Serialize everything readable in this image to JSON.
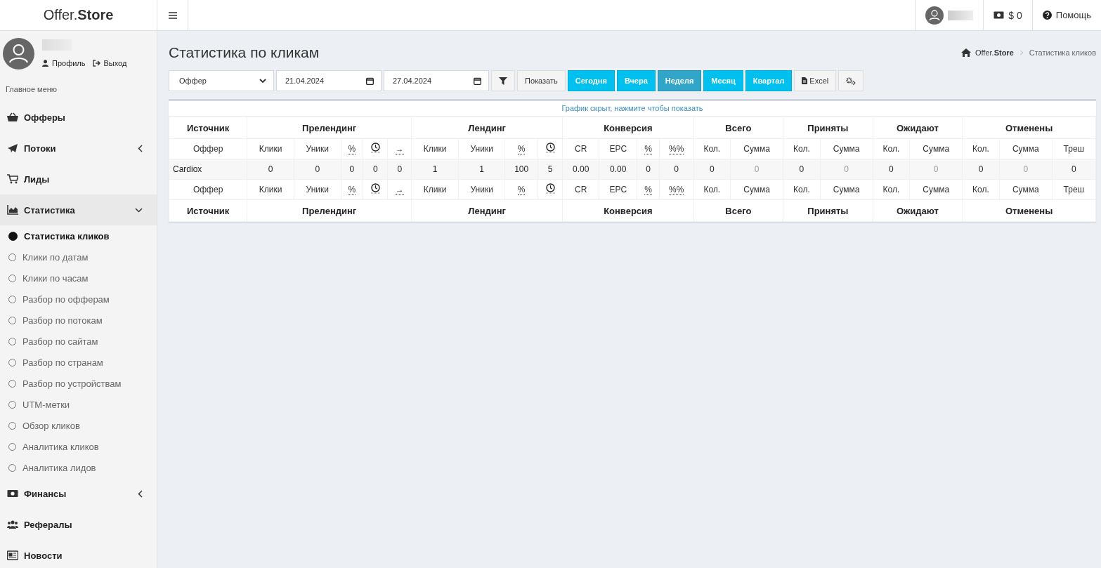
{
  "brand": "Offer.**Store**",
  "topbar": {
    "balance": "$ 0",
    "help": "Помощь"
  },
  "user_panel": {
    "links": [
      "Профиль",
      "Выход"
    ]
  },
  "menu_header": "Главное меню",
  "menu": [
    {
      "label": "Офферы"
    },
    {
      "label": "Потоки",
      "expanded": false
    },
    {
      "label": "Лиды"
    },
    {
      "label": "Статистика",
      "expanded": true,
      "children": [
        {
          "label": "Статистика кликов",
          "selected": true
        },
        {
          "label": "Клики по датам",
          "selected": false
        },
        {
          "label": "Клики по часам",
          "selected": false
        },
        {
          "label": "Разбор по офферам",
          "selected": false
        },
        {
          "label": "Разбор по потокам",
          "selected": false
        },
        {
          "label": "Разбор по сайтам",
          "selected": false
        },
        {
          "label": "Разбор по странам",
          "selected": false
        },
        {
          "label": "Разбор по устройствам",
          "selected": false
        },
        {
          "label": "UTM-метки",
          "selected": false
        },
        {
          "label": "Обзор кликов",
          "selected": false
        },
        {
          "label": "Аналитика кликов",
          "selected": false
        },
        {
          "label": "Аналитика лидов",
          "selected": false
        }
      ]
    },
    {
      "label": "Финансы",
      "expanded": false
    },
    {
      "label": "Рефералы"
    },
    {
      "label": "Новости"
    }
  ],
  "page_title": "Статистика по кликам",
  "breadcrumb": {
    "home": "Offer.**Store**",
    "current": "Статистика кликов"
  },
  "filters": {
    "select": "Оффер",
    "date_from": "21.04.2024",
    "date_to": "27.04.2024"
  },
  "buttons": [
    {
      "kind": "filter"
    },
    {
      "kind": "default",
      "label": "Показать"
    },
    {
      "kind": "period",
      "label": "Сегодня",
      "selected": false
    },
    {
      "kind": "period",
      "label": "Вчера",
      "selected": false
    },
    {
      "kind": "period",
      "label": "Неделя",
      "selected": true
    },
    {
      "kind": "period",
      "label": "Месяц",
      "selected": false
    },
    {
      "kind": "period",
      "label": "Квартал",
      "selected": false
    },
    {
      "kind": "excel",
      "label": "Excel"
    },
    {
      "kind": "settings"
    }
  ],
  "chart_toggle": "График скрыт, нажмите чтобы показать",
  "table": {
    "header": [
      {
        "label": "Источник",
        "columns": [
          {
            "kind": "text",
            "label": "Оффер"
          }
        ]
      },
      {
        "label": "Прелендинг",
        "columns": [
          {
            "kind": "text",
            "label": "Клики"
          },
          {
            "kind": "text",
            "label": "Уники"
          },
          {
            "kind": "abbr",
            "label": "%"
          },
          {
            "kind": "clock"
          },
          {
            "kind": "abbr",
            "label": "→"
          }
        ]
      },
      {
        "label": "Лендинг",
        "columns": [
          {
            "kind": "text",
            "label": "Клики"
          },
          {
            "kind": "text",
            "label": "Уники"
          },
          {
            "kind": "abbr",
            "label": "%"
          },
          {
            "kind": "clock"
          }
        ]
      },
      {
        "label": "Конверсия",
        "columns": [
          {
            "kind": "text",
            "label": "CR"
          },
          {
            "kind": "text",
            "label": "EPC"
          },
          {
            "kind": "abbr",
            "label": "%"
          },
          {
            "kind": "abbr",
            "label": "%%"
          }
        ]
      },
      {
        "label": "Всего",
        "columns": [
          {
            "kind": "text",
            "label": "Кол."
          },
          {
            "kind": "text",
            "label": "Сумма"
          }
        ]
      },
      {
        "label": "Приняты",
        "columns": [
          {
            "kind": "text",
            "label": "Кол."
          },
          {
            "kind": "text",
            "label": "Сумма"
          }
        ]
      },
      {
        "label": "Ожидают",
        "columns": [
          {
            "kind": "text",
            "label": "Кол."
          },
          {
            "kind": "text",
            "label": "Сумма"
          }
        ]
      },
      {
        "label": "Отменены",
        "columns": [
          {
            "kind": "text",
            "label": "Кол."
          },
          {
            "kind": "text",
            "label": "Сумма"
          },
          {
            "kind": "text",
            "label": "Треш"
          }
        ]
      }
    ],
    "rows": [
      [
        {
          "text": "Cardiox",
          "muted": false
        },
        {
          "text": "0",
          "muted": false
        },
        {
          "text": "0",
          "muted": false
        },
        {
          "text": "0",
          "muted": false
        },
        {
          "text": "0",
          "muted": false
        },
        {
          "text": "0",
          "muted": false
        },
        {
          "text": "1",
          "muted": false
        },
        {
          "text": "1",
          "muted": false
        },
        {
          "text": "100",
          "muted": false
        },
        {
          "text": "5",
          "muted": false
        },
        {
          "text": "0.00",
          "muted": false
        },
        {
          "text": "0.00",
          "muted": false
        },
        {
          "text": "0",
          "muted": false
        },
        {
          "text": "0",
          "muted": false
        },
        {
          "text": "0",
          "muted": false
        },
        {
          "text": "0",
          "muted": true
        },
        {
          "text": "0",
          "muted": false
        },
        {
          "text": "0",
          "muted": true
        },
        {
          "text": "0",
          "muted": false
        },
        {
          "text": "0",
          "muted": true
        },
        {
          "text": "0",
          "muted": false
        },
        {
          "text": "0",
          "muted": true
        },
        {
          "text": "0",
          "muted": false
        }
      ]
    ],
    "footer": [
      {
        "label": "Источник",
        "columns": [
          {
            "kind": "text",
            "label": "Оффер"
          }
        ]
      },
      {
        "label": "Прелендинг",
        "columns": [
          {
            "kind": "text",
            "label": "Клики"
          },
          {
            "kind": "text",
            "label": "Уники"
          },
          {
            "kind": "abbr",
            "label": "%"
          },
          {
            "kind": "clock"
          },
          {
            "kind": "abbr",
            "label": "→"
          }
        ]
      },
      {
        "label": "Лендинг",
        "columns": [
          {
            "kind": "text",
            "label": "Клики"
          },
          {
            "kind": "text",
            "label": "Уники"
          },
          {
            "kind": "abbr",
            "label": "%"
          },
          {
            "kind": "clock"
          }
        ]
      },
      {
        "label": "Конверсия",
        "columns": [
          {
            "kind": "text",
            "label": "CR"
          },
          {
            "kind": "text",
            "label": "EPC"
          },
          {
            "kind": "abbr",
            "label": "%"
          },
          {
            "kind": "abbr",
            "label": "%%"
          }
        ]
      },
      {
        "label": "Всего",
        "columns": [
          {
            "kind": "text",
            "label": "Кол."
          },
          {
            "kind": "text",
            "label": "Сумма"
          }
        ]
      },
      {
        "label": "Приняты",
        "columns": [
          {
            "kind": "text",
            "label": "Кол."
          },
          {
            "kind": "text",
            "label": "Сумма"
          }
        ]
      },
      {
        "label": "Ожидают",
        "columns": [
          {
            "kind": "text",
            "label": "Кол."
          },
          {
            "kind": "text",
            "label": "Сумма"
          }
        ]
      },
      {
        "label": "Отменены",
        "columns": [
          {
            "kind": "text",
            "label": "Кол."
          },
          {
            "kind": "text",
            "label": "Сумма"
          },
          {
            "kind": "text",
            "label": "Треш"
          }
        ]
      }
    ]
  }
}
